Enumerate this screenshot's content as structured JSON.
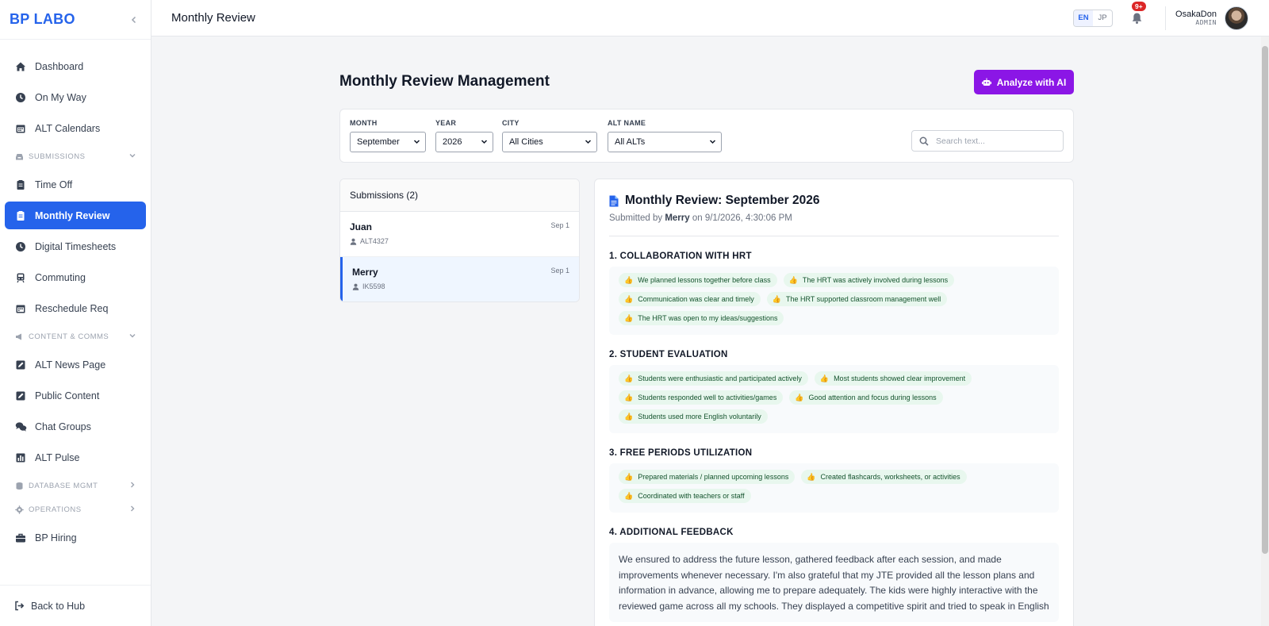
{
  "brand": "BP LABO",
  "sidebar": {
    "items": [
      {
        "label": "Dashboard"
      },
      {
        "label": "On My Way"
      },
      {
        "label": "ALT Calendars"
      },
      {
        "section": "SUBMISSIONS"
      },
      {
        "label": "Time Off"
      },
      {
        "label": "Monthly Review"
      },
      {
        "label": "Digital Timesheets"
      },
      {
        "label": "Commuting"
      },
      {
        "label": "Reschedule Req"
      },
      {
        "section": "CONTENT & COMMS"
      },
      {
        "label": "ALT News Page"
      },
      {
        "label": "Public Content"
      },
      {
        "label": "Chat Groups"
      },
      {
        "label": "ALT Pulse"
      },
      {
        "section": "DATABASE MGMT"
      },
      {
        "section": "OPERATIONS"
      },
      {
        "label": "BP Hiring"
      }
    ],
    "footer": "Back to Hub"
  },
  "header": {
    "title": "Monthly Review",
    "lang": [
      "EN",
      "JP"
    ],
    "notification_count": "9+",
    "user_name": "OsakaDon",
    "user_role": "ADMIN"
  },
  "main": {
    "heading": "Monthly Review Management",
    "ai_button": "Analyze with AI",
    "filters": {
      "month_label": "MONTH",
      "month_value": "September",
      "year_label": "YEAR",
      "year_value": "2026",
      "city_label": "CITY",
      "city_value": "All Cities",
      "alt_label": "ALT NAME",
      "alt_value": "All ALTs",
      "search_placeholder": "Search text..."
    },
    "submissions_title": "Submissions (2)",
    "submissions": [
      {
        "name": "Juan",
        "id": "ALT4327",
        "date": "Sep 1"
      },
      {
        "name": "Merry",
        "id": "IK5598",
        "date": "Sep 1"
      }
    ]
  },
  "detail": {
    "title": "Monthly Review: September 2026",
    "submitted_prefix": "Submitted by",
    "submitted_by": "Merry",
    "submitted_suffix": "on 9/1/2026, 4:30:06 PM",
    "sections": [
      {
        "title": "1. COLLABORATION WITH HRT",
        "tags": [
          "We planned lessons together before class",
          "The HRT was actively involved during lessons",
          "Communication was clear and timely",
          "The HRT supported classroom management well",
          "The HRT was open to my ideas/suggestions"
        ]
      },
      {
        "title": "2. STUDENT EVALUATION",
        "tags": [
          "Students were enthusiastic and participated actively",
          "Most students showed clear improvement",
          "Students responded well to activities/games",
          "Good attention and focus during lessons",
          "Students used more English voluntarily"
        ]
      },
      {
        "title": "3. FREE PERIODS UTILIZATION",
        "tags": [
          "Prepared materials / planned upcoming lessons",
          "Created flashcards, worksheets, or activities",
          "Coordinated with teachers or staff"
        ]
      }
    ],
    "feedback_title": "4. ADDITIONAL FEEDBACK",
    "feedback_text": "We ensured to address the future lesson, gathered feedback after each session, and made improvements whenever necessary. I'm also grateful that my JTE provided all the lesson plans and information in advance, allowing me to prepare adequately. The kids were highly interactive with the reviewed game across all my schools. They displayed a competitive spirit and tried to speak in English"
  },
  "colors": {
    "accent": "#2563eb",
    "ai_button": "#8b16e6",
    "tag_bg": "#e8f7ee",
    "badge": "#dc2626"
  },
  "icons": {
    "tag": "thumbs-up-icon",
    "doc": "document-icon"
  }
}
